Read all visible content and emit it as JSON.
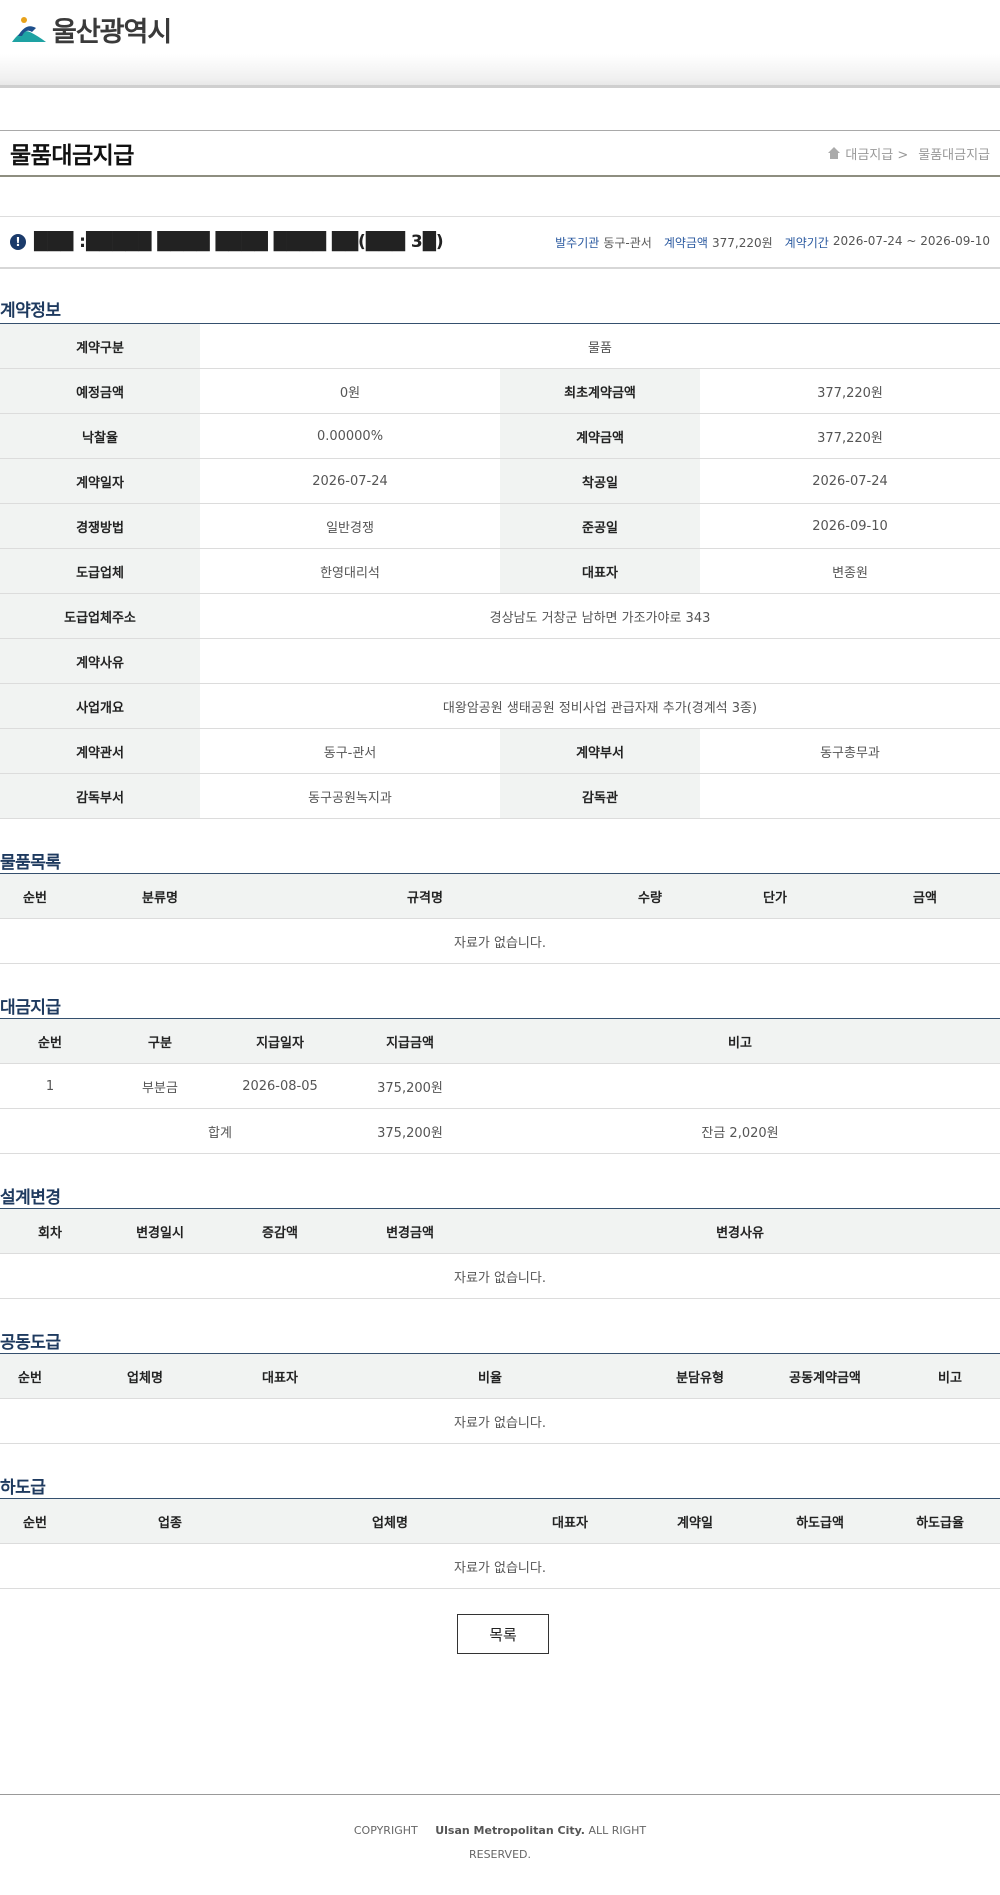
{
  "header": {
    "site_name": "울산광역시"
  },
  "page": {
    "title": "물품대금지급",
    "breadcrumb": [
      "대금지급 >",
      "물품대금지급"
    ]
  },
  "contract": {
    "name": "███ :█████ ████ ████ ████ ██(███ 3█)",
    "order_agency_label": "발주기관",
    "order_agency": "동구-관서",
    "amount_label": "계약금액",
    "amount": "377,220원",
    "period_label": "계약기간",
    "period": "2026-07-24 ~ 2026-09-10"
  },
  "contract_info": {
    "title": "계약정보",
    "type_label": "계약구분",
    "type": "물품",
    "estimated_label": "예정금액",
    "estimated": "0원",
    "initial_label": "최초계약금액",
    "initial": "377,220원",
    "rate_label": "낙찰율",
    "rate": "0.00000%",
    "amount_label": "계약금액",
    "amount": "377,220원",
    "date_label": "계약일자",
    "date": "2026-07-24",
    "start_label": "착공일",
    "start": "2026-07-24",
    "method_label": "경쟁방법",
    "method": "일반경쟁",
    "end_label": "준공일",
    "end": "2026-09-10",
    "vendor_label": "도급업체",
    "vendor": "한영대리석",
    "ceo_label": "대표자",
    "ceo": "변종원",
    "address_label": "도급업체주소",
    "address": "경상남도 거창군 남하면 가조가야로 343",
    "reason_label": "계약사유",
    "reason": "",
    "summary_label": "사업개요",
    "summary": "대왕암공원 생태공원 정비사업 관급자재 추가(경계석 3종)",
    "office_label": "계약관서",
    "office": "동구-관서",
    "dept_label": "계약부서",
    "dept": "동구총무과",
    "supervise_dept_label": "감독부서",
    "supervise_dept": "동구공원녹지과",
    "supervisor_label": "감독관",
    "supervisor": ""
  },
  "goods": {
    "title": "물품목록",
    "headers": [
      "순번",
      "분류명",
      "규격명",
      "수량",
      "단가",
      "금액"
    ],
    "empty": "자료가 없습니다."
  },
  "payments": {
    "title": "대금지급",
    "headers": [
      "순번",
      "구분",
      "지급일자",
      "지급금액",
      "비고"
    ],
    "rows": [
      {
        "no": "1",
        "type": "부분금",
        "date": "2026-08-05",
        "amount": "375,200원",
        "note": ""
      }
    ],
    "total_label": "합계",
    "total_amount": "375,200원",
    "balance": "잔금 2,020원"
  },
  "design_change": {
    "title": "설계변경",
    "headers": [
      "회차",
      "변경일시",
      "증감액",
      "변경금액",
      "변경사유"
    ],
    "empty": "자료가 없습니다."
  },
  "joint": {
    "title": "공동도급",
    "headers": [
      "순번",
      "업체명",
      "대표자",
      "비율",
      "분담유형",
      "공동계약금액",
      "비고"
    ],
    "empty": "자료가 없습니다."
  },
  "subcontract": {
    "title": "하도급",
    "headers": [
      "순번",
      "업종",
      "업체명",
      "대표자",
      "계약일",
      "하도급액",
      "하도급율"
    ],
    "empty": "자료가 없습니다."
  },
  "list_button": "목록",
  "footer": {
    "copyright": "COPYRIGHT",
    "org": "Ulsan Metropolitan City.",
    "rights1": "ALL RIGHT",
    "rights2": "RESERVED."
  }
}
